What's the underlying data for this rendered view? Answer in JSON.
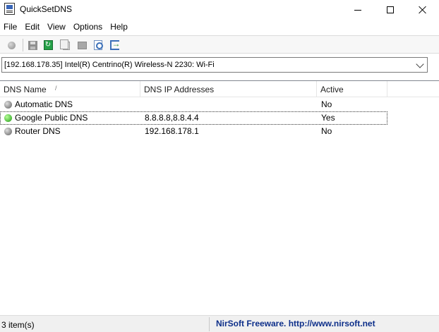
{
  "window": {
    "title": "QuickSetDNS"
  },
  "menu": [
    "File",
    "Edit",
    "View",
    "Options",
    "Help"
  ],
  "toolbar": {
    "icons": [
      "disc-icon",
      "save-icon",
      "refresh-icon",
      "copy-icon",
      "export-icon",
      "find-icon",
      "exit-icon"
    ]
  },
  "adapter": {
    "value": "[192.168.178.35]  Intel(R) Centrino(R) Wireless-N 2230: Wi-Fi"
  },
  "list": {
    "columns": {
      "name": "DNS Name",
      "sort_indicator": "/",
      "ip": "DNS IP Addresses",
      "active": "Active"
    },
    "rows": [
      {
        "name": "Automatic DNS",
        "ip": "",
        "active": "No",
        "status": "gray"
      },
      {
        "name": "Google Public DNS",
        "ip": "8.8.8.8,8.8.4.4",
        "active": "Yes",
        "status": "green",
        "selected": true
      },
      {
        "name": "Router DNS",
        "ip": "192.168.178.1",
        "active": "No",
        "status": "gray"
      }
    ]
  },
  "status": {
    "count": "3 item(s)",
    "credit": "NirSoft Freeware.  http://www.nirsoft.net"
  },
  "colors": {
    "status_green": "#1f9a14",
    "status_gray": "#5c5c5c",
    "credit_text": "#0d2f8a"
  }
}
